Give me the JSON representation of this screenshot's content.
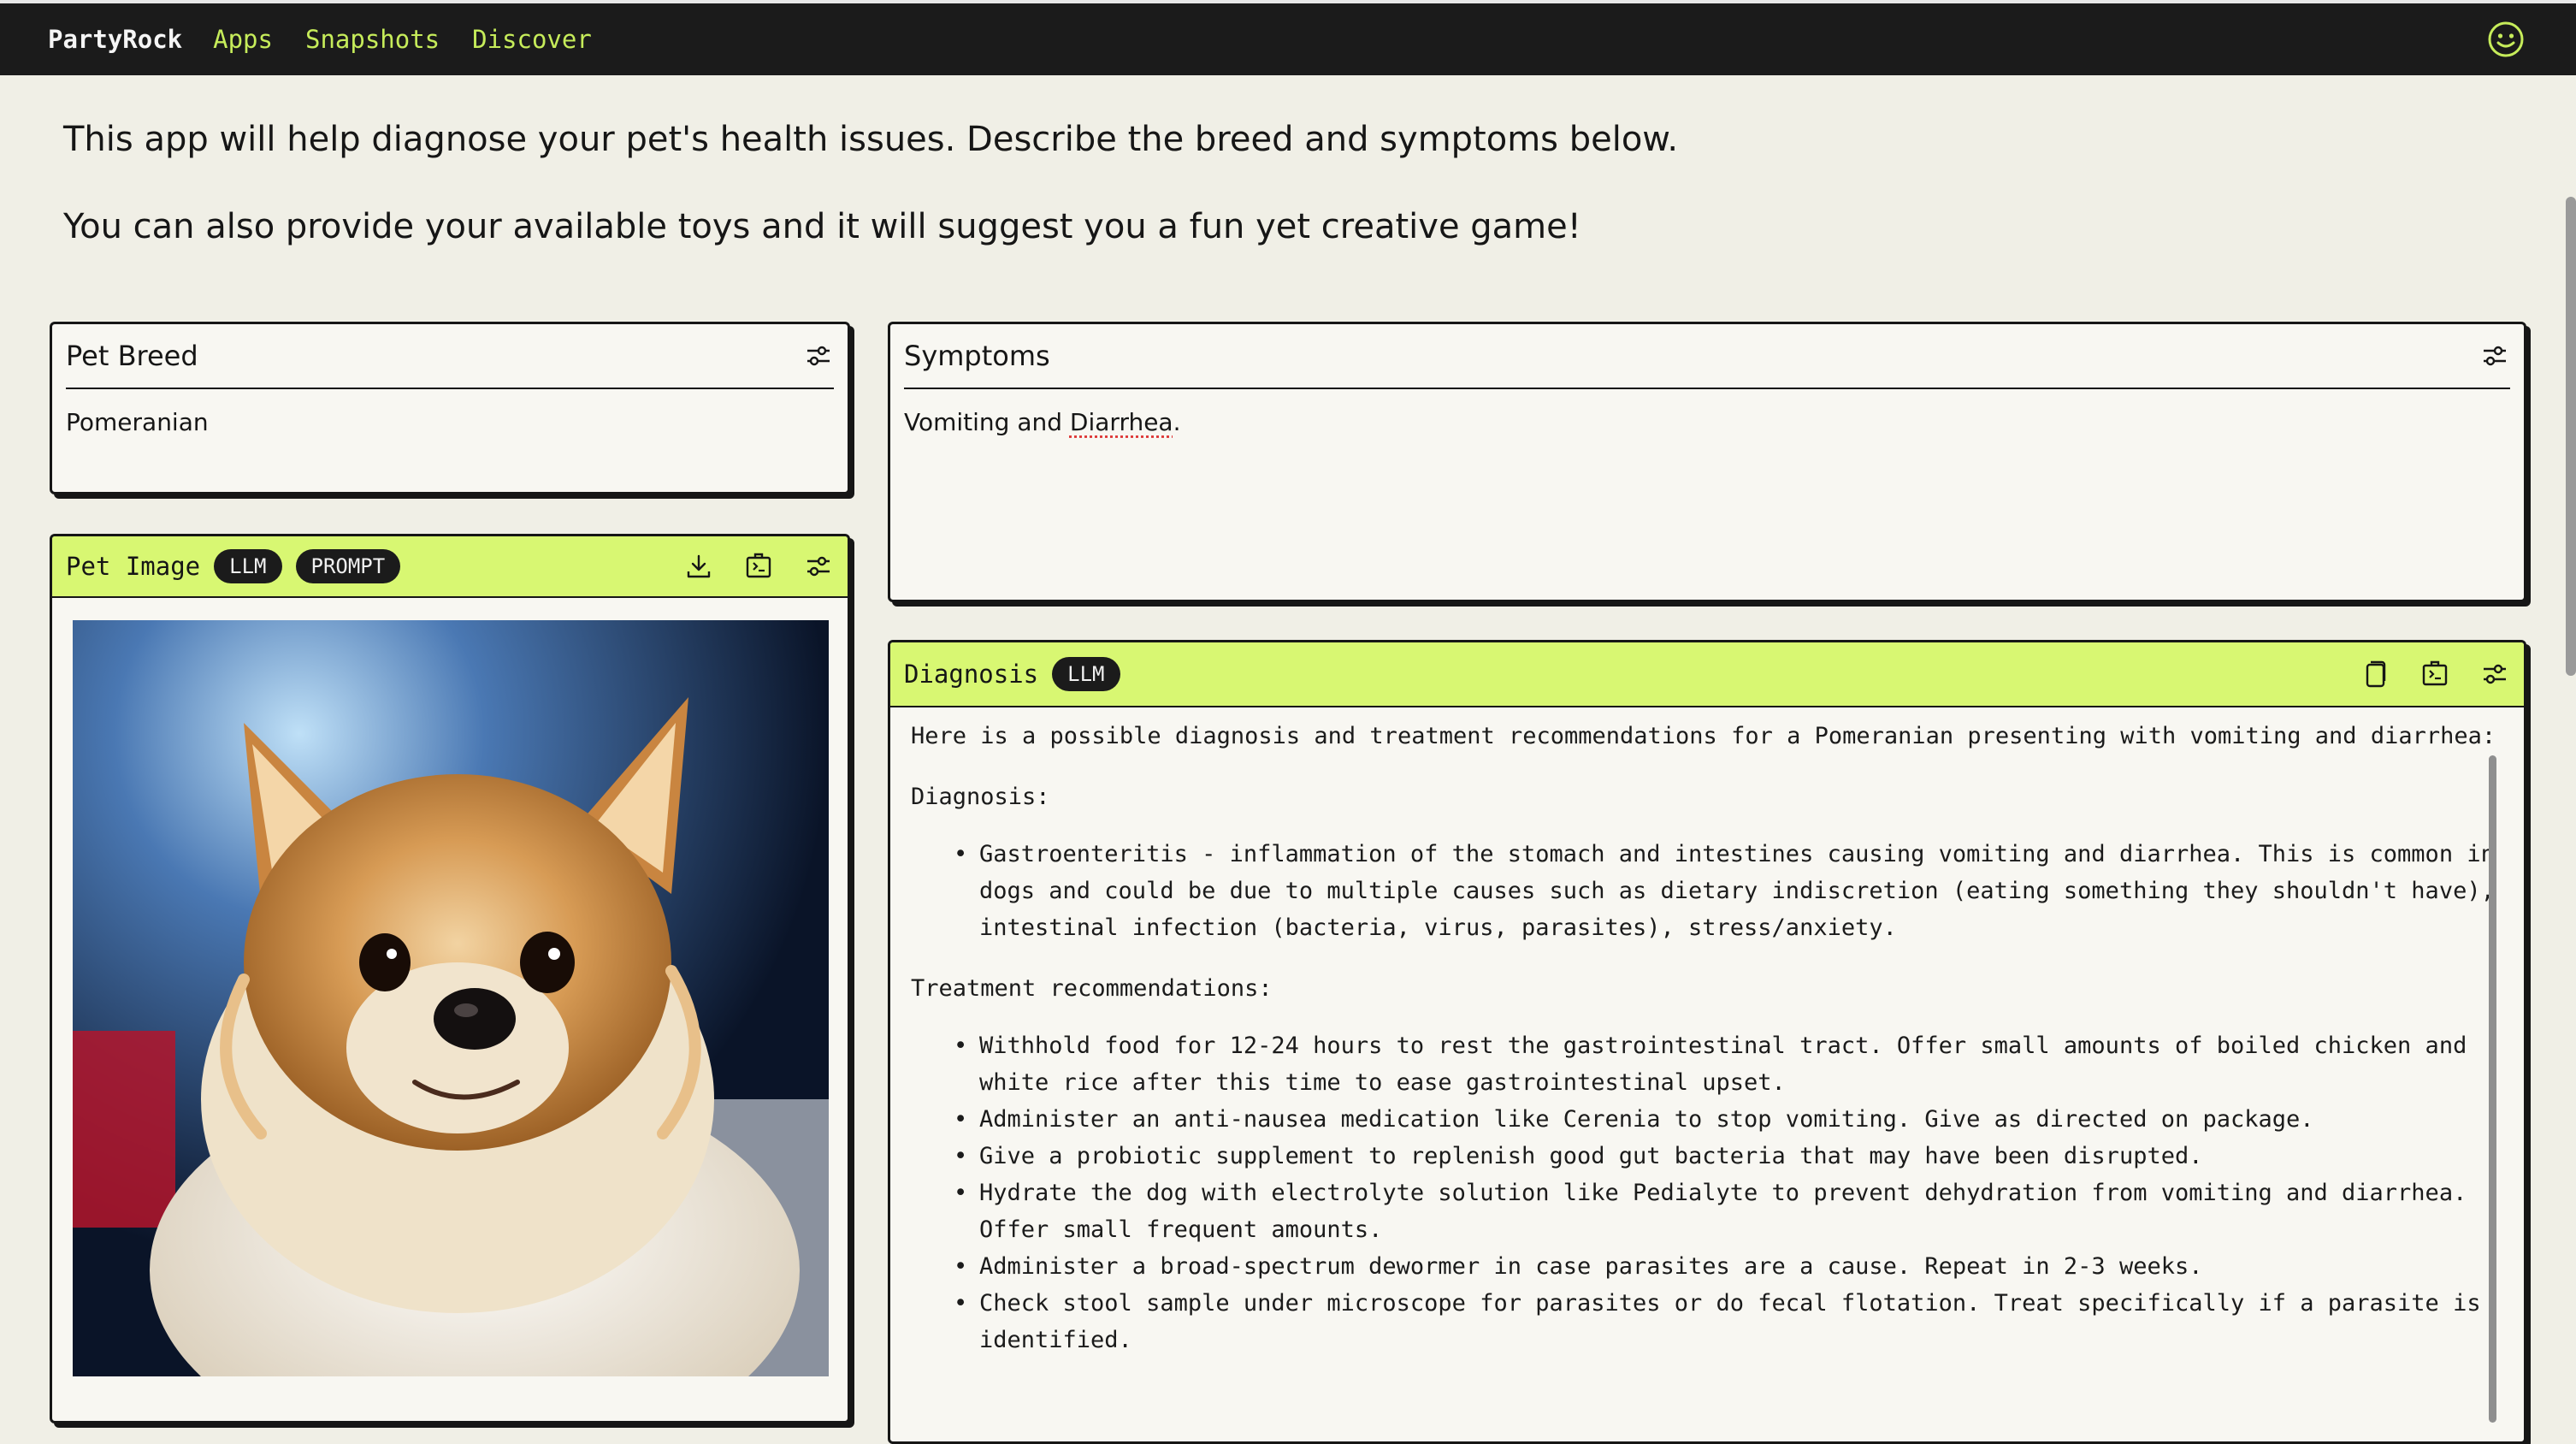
{
  "nav": {
    "brand": "PartyRock",
    "links": [
      "Apps",
      "Snapshots",
      "Discover"
    ],
    "profile_icon": "smiley-icon"
  },
  "intro": {
    "line1": "This app will help diagnose your pet's health issues. Describe the breed and symptoms below.",
    "line2": "You can also provide your available toys and it will suggest you a fun yet creative game!"
  },
  "pet_breed": {
    "title": "Pet Breed",
    "value": "Pomeranian"
  },
  "symptoms": {
    "title": "Symptoms",
    "value_a": "Vomiting and ",
    "value_b": "Diarrhea",
    "value_c": "."
  },
  "pet_image": {
    "title": "Pet Image",
    "badges": [
      "LLM",
      "PROMPT"
    ]
  },
  "diagnosis": {
    "title": "Diagnosis",
    "badge": "LLM",
    "intro": "Here is a possible diagnosis and treatment recommendations for a Pomeranian presenting with vomiting and diarrhea:",
    "diagnosis_heading": "Diagnosis:",
    "diagnosis_items": [
      "Gastroenteritis - inflammation of the stomach and intestines causing vomiting and diarrhea. This is common in dogs and could be due to multiple causes such as dietary indiscretion (eating something they shouldn't have), intestinal infection (bacteria, virus, parasites), stress/anxiety."
    ],
    "treatment_heading": "Treatment recommendations:",
    "treatment_items": [
      "Withhold food for 12-24 hours to rest the gastrointestinal tract. Offer small amounts of boiled chicken and white rice after this time to ease gastrointestinal upset.",
      "Administer an anti-nausea medication like Cerenia to stop vomiting. Give as directed on package.",
      "Give a probiotic supplement to replenish good gut bacteria that may have been disrupted.",
      "Hydrate the dog with electrolyte solution like Pedialyte to prevent dehydration from vomiting and diarrhea. Offer small frequent amounts.",
      "Administer a broad-spectrum dewormer in case parasites are a cause. Repeat in 2-3 weeks.",
      "Check stool sample under microscope for parasites or do fecal flotation. Treat specifically if a parasite is identified."
    ]
  },
  "colors": {
    "accent": "#d8f772",
    "nav_link": "#c6ec5a",
    "nav_bg": "#1b1b1b",
    "page_bg": "#f0efe6"
  }
}
